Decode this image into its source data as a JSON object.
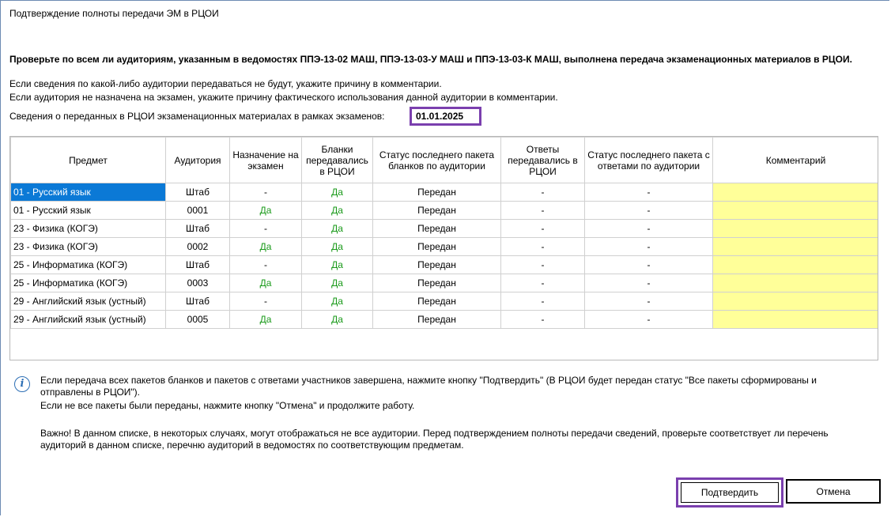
{
  "window": {
    "title": "Подтверждение полноты передачи ЭМ в РЦОИ"
  },
  "heading": "Проверьте по всем ли аудиториям, указанным в ведомостях ППЭ-13-02 МАШ, ППЭ-13-03-У МАШ и ППЭ-13-03-К МАШ, выполнена передача экзаменационных материалов в РЦОИ.",
  "instructions": {
    "line1": "Если сведения по какой-либо аудитории передаваться не будут, укажите причину в комментарии.",
    "line2": "Если аудитория не назначена на экзамен, укажите причину фактического использования данной аудитории в комментарии.",
    "exam_label": "Сведения о переданных в РЦОИ экзаменационных материалах в рамках экзаменов:",
    "exam_date": "01.01.2025"
  },
  "table": {
    "headers": {
      "subject": "Предмет",
      "room": "Аудитория",
      "assigned": "Назначение на экзамен",
      "forms_sent": "Бланки передавались в РЦОИ",
      "forms_status": "Статус последнего пакета бланков по аудитории",
      "answers_sent": "Ответы передавались в РЦОИ",
      "answers_status": "Статус последнего пакета с ответами по аудитории",
      "comment": "Комментарий"
    },
    "rows": [
      {
        "subject": "01 - Русский язык",
        "room": "Штаб",
        "assigned": "-",
        "forms_sent": "Да",
        "forms_status": "Передан",
        "answers_sent": "-",
        "answers_status": "-",
        "comment": ""
      },
      {
        "subject": "01 - Русский язык",
        "room": "0001",
        "assigned": "Да",
        "forms_sent": "Да",
        "forms_status": "Передан",
        "answers_sent": "-",
        "answers_status": "-",
        "comment": ""
      },
      {
        "subject": "23 - Физика (КОГЭ)",
        "room": "Штаб",
        "assigned": "-",
        "forms_sent": "Да",
        "forms_status": "Передан",
        "answers_sent": "-",
        "answers_status": "-",
        "comment": ""
      },
      {
        "subject": "23 - Физика (КОГЭ)",
        "room": "0002",
        "assigned": "Да",
        "forms_sent": "Да",
        "forms_status": "Передан",
        "answers_sent": "-",
        "answers_status": "-",
        "comment": ""
      },
      {
        "subject": "25 - Информатика (КОГЭ)",
        "room": "Штаб",
        "assigned": "-",
        "forms_sent": "Да",
        "forms_status": "Передан",
        "answers_sent": "-",
        "answers_status": "-",
        "comment": ""
      },
      {
        "subject": "25 - Информатика (КОГЭ)",
        "room": "0003",
        "assigned": "Да",
        "forms_sent": "Да",
        "forms_status": "Передан",
        "answers_sent": "-",
        "answers_status": "-",
        "comment": ""
      },
      {
        "subject": "29 - Английский язык (устный)",
        "room": "Штаб",
        "assigned": "-",
        "forms_sent": "Да",
        "forms_status": "Передан",
        "answers_sent": "-",
        "answers_status": "-",
        "comment": ""
      },
      {
        "subject": "29 - Английский язык (устный)",
        "room": "0005",
        "assigned": "Да",
        "forms_sent": "Да",
        "forms_status": "Передан",
        "answers_sent": "-",
        "answers_status": "-",
        "comment": ""
      }
    ],
    "selected_row": 0
  },
  "info": {
    "icon": "info-icon",
    "para1_line1": "Если передача всех пакетов бланков и пакетов с ответами участников завершена, нажмите кнопку \"Подтвердить\" (В РЦОИ будет передан статус \"Все пакеты сформированы и",
    "para1_line2": "отправлены в РЦОИ\").",
    "para1_line3": "Если не все пакеты были переданы, нажмите кнопку \"Отмена\" и продолжите работу.",
    "para2_line1": "Важно! В данном списке, в некоторых случаях, могут отображаться не все аудитории. Перед подтверждением полноты передачи сведений, проверьте соответствует ли перечень",
    "para2_line2": "аудиторий в данном списке, перечню аудиторий в ведомостях по соответствующим предметам."
  },
  "buttons": {
    "confirm": "Подтвердить",
    "cancel": "Отмена"
  },
  "colors": {
    "selection": "#0b79d6",
    "comment_fill": "#ffff99",
    "yes_text": "#1a9a1a",
    "highlight_frame": "#7a3fae"
  }
}
